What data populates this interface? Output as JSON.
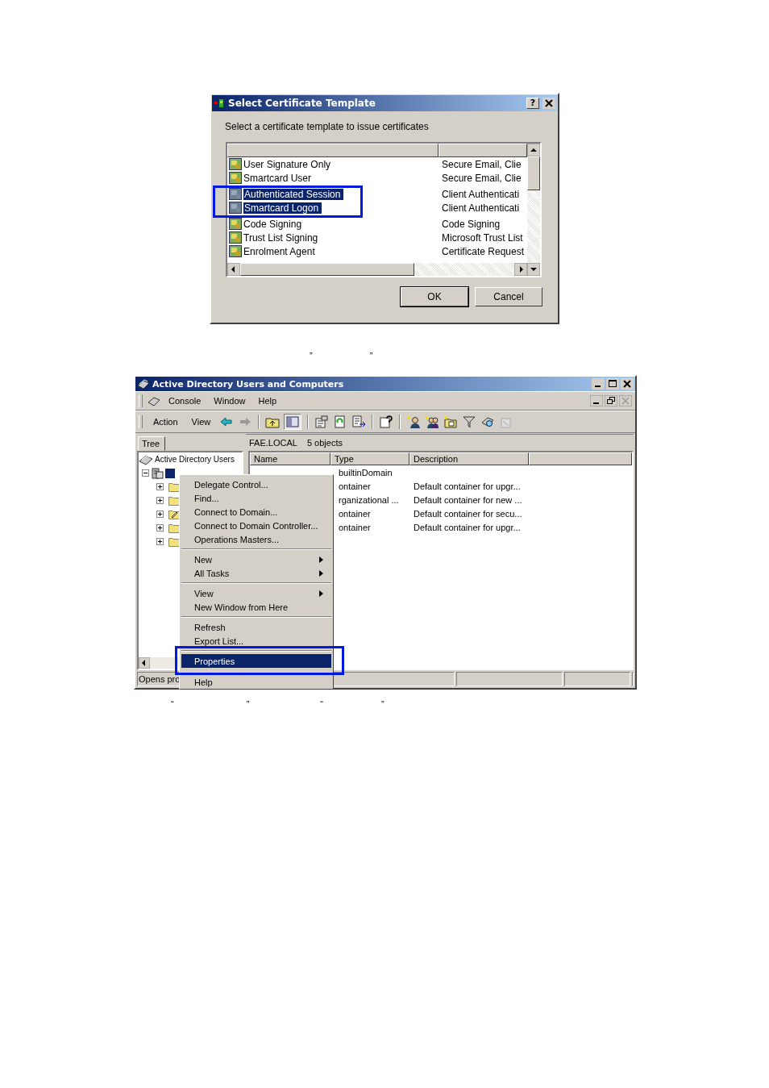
{
  "quotes_top": [
    "”",
    "”"
  ],
  "dialog": {
    "title": "Select Certificate Template",
    "help_button": "?",
    "prompt": "Select a certificate template to issue certificates",
    "rows": [
      {
        "name": "User Signature Only",
        "purpose": "Secure Email, Clie",
        "selected": false
      },
      {
        "name": "Smartcard User",
        "purpose": "Secure Email, Clie",
        "selected": false
      },
      {
        "name": "Authenticated Session",
        "purpose": "Client Authenticati",
        "selected": true
      },
      {
        "name": "Smartcard Logon",
        "purpose": "Client Authenticati",
        "selected": true
      },
      {
        "name": "Code Signing",
        "purpose": "Code Signing",
        "selected": false
      },
      {
        "name": "Trust List Signing",
        "purpose": "Microsoft Trust List",
        "selected": false
      },
      {
        "name": "Enrolment Agent",
        "purpose": "Certificate Request",
        "selected": false
      }
    ],
    "buttons": [
      {
        "label": "OK",
        "default": true
      },
      {
        "label": "Cancel",
        "default": false
      }
    ]
  },
  "window": {
    "title": "Active Directory Users and Computers",
    "menu": [
      "Console",
      "Window",
      "Help"
    ],
    "action_menu": [
      "Action",
      "View"
    ],
    "tree_tab": "Tree",
    "path": "FAE.LOCAL",
    "count": "5 objects",
    "tree": {
      "label": "Active Directory Users",
      "children": [
        {
          "expanded": true,
          "children": [
            {
              "kind": "folder",
              "expanded": false
            },
            {
              "kind": "folder",
              "expanded": false
            },
            {
              "kind": "ou",
              "expanded": false
            },
            {
              "kind": "folder",
              "expanded": false
            },
            {
              "kind": "folder",
              "expanded": false
            }
          ]
        }
      ]
    },
    "columns": [
      "Name",
      "Type",
      "Description"
    ],
    "rows": [
      {
        "type": "builtinDomain"
      },
      {
        "type": "ontainer",
        "description": "Default container for upgr..."
      },
      {
        "type": "rganizational ...",
        "description": "Default container for new ..."
      },
      {
        "type": "ontainer",
        "description": "Default container for secu..."
      },
      {
        "type": "ontainer",
        "description": "Default container for upgr..."
      }
    ],
    "status": "Opens pro",
    "context_menu": [
      [
        {
          "label": "Delegate Control...",
          "submenu": false,
          "selected": false
        },
        {
          "label": "Find...",
          "submenu": false,
          "selected": false
        },
        {
          "label": "Connect to Domain...",
          "submenu": false,
          "selected": false
        },
        {
          "label": "Connect to Domain Controller...",
          "submenu": false,
          "selected": false
        },
        {
          "label": "Operations Masters...",
          "submenu": false,
          "selected": false
        }
      ],
      [
        {
          "label": "New",
          "submenu": true,
          "selected": false
        },
        {
          "label": "All Tasks",
          "submenu": true,
          "selected": false
        }
      ],
      [
        {
          "label": "View",
          "submenu": true,
          "selected": false
        },
        {
          "label": "New Window from Here",
          "submenu": false,
          "selected": false
        }
      ],
      [
        {
          "label": "Refresh",
          "submenu": false,
          "selected": false
        },
        {
          "label": "Export List...",
          "submenu": false,
          "selected": false
        }
      ],
      [
        {
          "label": "Properties",
          "submenu": false,
          "selected": true
        },
        {
          "label": "Help",
          "submenu": false,
          "selected": false
        }
      ]
    ]
  },
  "quotes_bottom": [
    "“",
    "”",
    "“",
    "”"
  ]
}
